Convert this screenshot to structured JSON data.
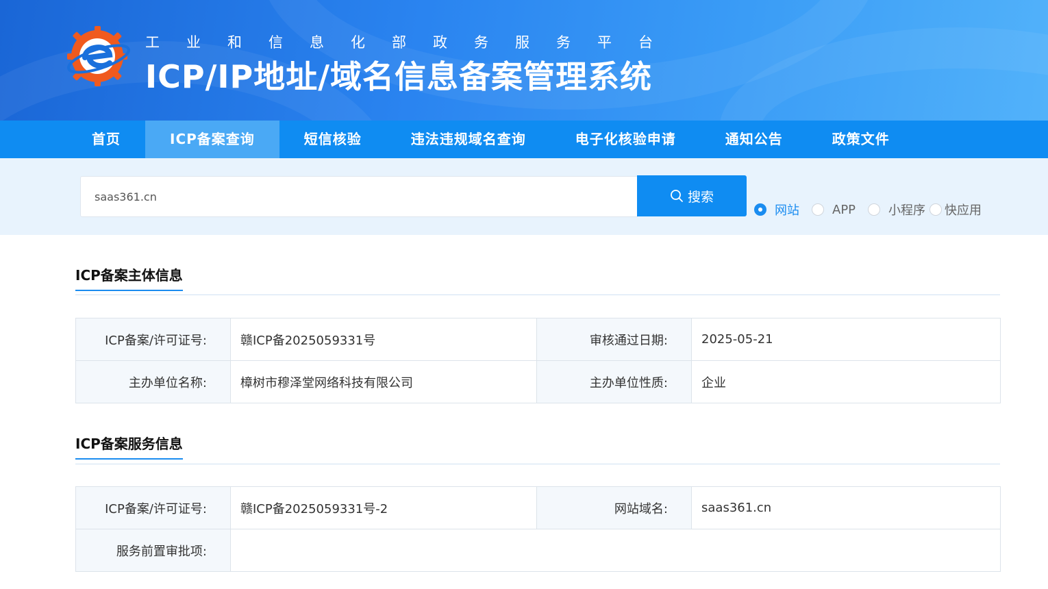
{
  "header": {
    "subtitle": "工业和信息化部政务服务平台",
    "title": "ICP/IP地址/域名信息备案管理系统"
  },
  "nav": {
    "items": [
      {
        "label": "首页",
        "active": false
      },
      {
        "label": "ICP备案查询",
        "active": true
      },
      {
        "label": "短信核验",
        "active": false
      },
      {
        "label": "违法违规域名查询",
        "active": false
      },
      {
        "label": "电子化核验申请",
        "active": false
      },
      {
        "label": "通知公告",
        "active": false
      },
      {
        "label": "政策文件",
        "active": false
      }
    ]
  },
  "search": {
    "value": "saas361.cn",
    "button_label": "搜索",
    "options": [
      {
        "label": "网站",
        "checked": true
      },
      {
        "label": "APP",
        "checked": false
      },
      {
        "label": "小程序",
        "checked": false
      },
      {
        "label": "快应用",
        "checked": false
      }
    ]
  },
  "subject_info": {
    "title": "ICP备案主体信息",
    "license_label": "ICP备案/许可证号:",
    "license_value": "赣ICP备2025059331号",
    "date_label": "审核通过日期:",
    "date_value": "2025-05-21",
    "org_label": "主办单位名称:",
    "org_value": "樟树市穆泽堂网络科技有限公司",
    "nature_label": "主办单位性质:",
    "nature_value": "企业"
  },
  "service_info": {
    "title": "ICP备案服务信息",
    "license_label": "ICP备案/许可证号:",
    "license_value": "赣ICP备2025059331号-2",
    "domain_label": "网站域名:",
    "domain_value": "saas361.cn",
    "approval_label": "服务前置审批项:",
    "approval_value": ""
  },
  "colors": {
    "primary": "#0f8cf2",
    "nav_active": "#4aa9f5",
    "search_bg": "#e8f3fd",
    "logo_orange": "#f05a1e"
  }
}
